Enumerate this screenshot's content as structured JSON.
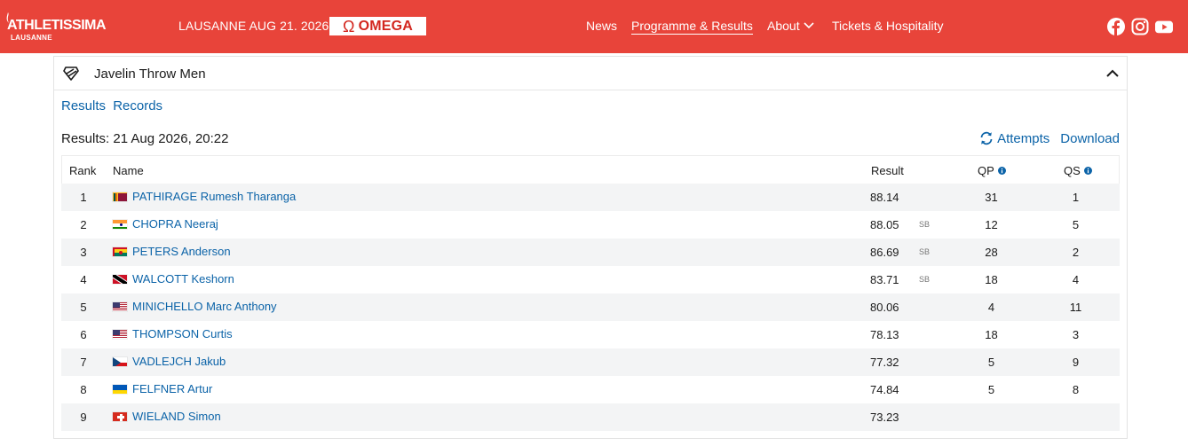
{
  "header": {
    "logo_main": "ATHLETISSIMA",
    "logo_sub": "LAUSANNE",
    "event_date": "LAUSANNE AUG 21. 2026",
    "sponsor": "OMEGA",
    "sponsor_glyph": "Ω",
    "nav": [
      {
        "label": "News"
      },
      {
        "label": "Programme & Results"
      },
      {
        "label": "About"
      },
      {
        "label": "Tickets & Hospitality"
      }
    ],
    "social_icons": [
      "facebook-icon",
      "instagram-icon",
      "youtube-icon"
    ],
    "bar_color": "#e8443a"
  },
  "event": {
    "title": "Javelin Throw Men",
    "tabs": [
      "Results",
      "Records"
    ],
    "results_stamp": "Results: 21 Aug 2026, 20:22",
    "actions": {
      "attempts": "Attempts",
      "download": "Download"
    }
  },
  "table": {
    "columns": {
      "rank": "Rank",
      "name": "Name",
      "result": "Result",
      "qp": "QP",
      "qs": "QS"
    },
    "rows": [
      {
        "rank": "1",
        "flag": "SRI",
        "name": "PATHIRAGE Rumesh Tharanga",
        "result": "88.14",
        "note": "",
        "qp": "31",
        "qs": "1"
      },
      {
        "rank": "2",
        "flag": "IND",
        "name": "CHOPRA Neeraj",
        "result": "88.05",
        "note": "SB",
        "qp": "12",
        "qs": "5"
      },
      {
        "rank": "3",
        "flag": "GRN",
        "name": "PETERS Anderson",
        "result": "86.69",
        "note": "SB",
        "qp": "28",
        "qs": "2"
      },
      {
        "rank": "4",
        "flag": "TTO",
        "name": "WALCOTT Keshorn",
        "result": "83.71",
        "note": "SB",
        "qp": "18",
        "qs": "4"
      },
      {
        "rank": "5",
        "flag": "USA",
        "name": "MINICHELLO Marc Anthony",
        "result": "80.06",
        "note": "",
        "qp": "4",
        "qs": "11"
      },
      {
        "rank": "6",
        "flag": "USA",
        "name": "THOMPSON Curtis",
        "result": "78.13",
        "note": "",
        "qp": "18",
        "qs": "3"
      },
      {
        "rank": "7",
        "flag": "CZE",
        "name": "VADLEJCH Jakub",
        "result": "77.32",
        "note": "",
        "qp": "5",
        "qs": "9"
      },
      {
        "rank": "8",
        "flag": "UKR",
        "name": "FELFNER Artur",
        "result": "74.84",
        "note": "",
        "qp": "5",
        "qs": "8"
      },
      {
        "rank": "9",
        "flag": "SUI",
        "name": "WIELAND Simon",
        "result": "73.23",
        "note": "",
        "qp": "",
        "qs": ""
      }
    ]
  },
  "colors": {
    "link": "#0b63a8",
    "row_stripe": "#f3f4f5"
  }
}
